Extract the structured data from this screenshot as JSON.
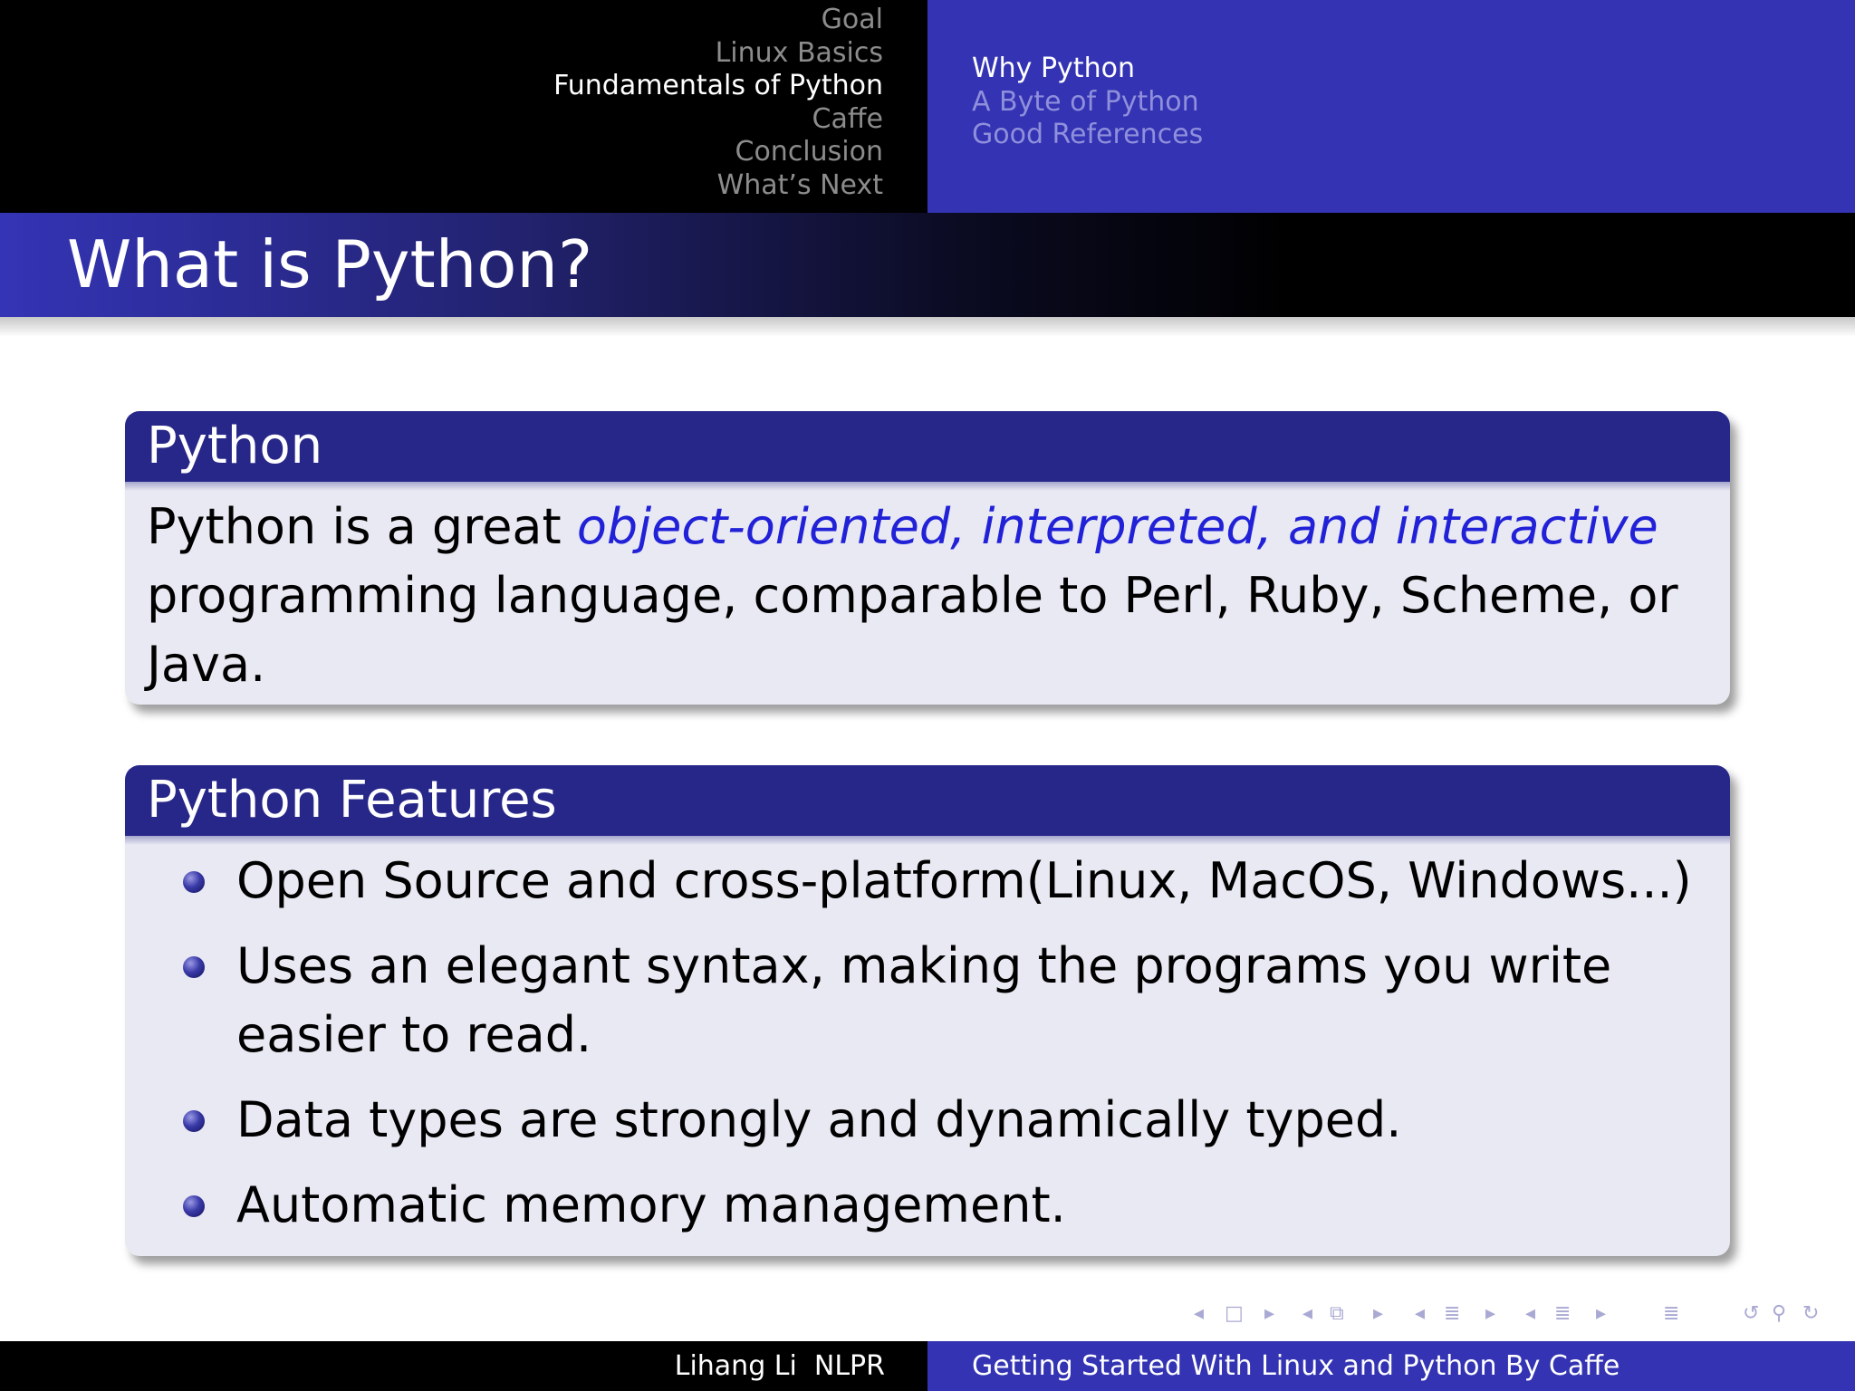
{
  "header": {
    "sections": [
      "Goal",
      "Linux Basics",
      "Fundamentals of Python",
      "Caffe",
      "Conclusion",
      "What’s Next"
    ],
    "active_section": "Fundamentals of Python",
    "subsections": [
      "Why Python",
      "A Byte of Python",
      "Good References"
    ],
    "active_subsection": "Why Python"
  },
  "frame": {
    "title": "What is Python?"
  },
  "block_python": {
    "title": "Python",
    "text_before": "Python is a great ",
    "emphasis": "object-oriented, interpreted, and interactive",
    "text_after": " programming language, comparable to Perl, Ruby, Scheme, or Java."
  },
  "block_features": {
    "title": "Python Features",
    "items": [
      "Open Source and cross-platform(Linux, MacOS, Windows...)",
      "Uses an elegant syntax, making the programs you write easier to read.",
      "Data types are strongly and dynamically typed.",
      "Automatic memory management."
    ]
  },
  "navigation": {
    "symbols": [
      "◂",
      "□",
      "▸",
      "◂",
      "⧉",
      "▸",
      "◂",
      "≣",
      "▸",
      "◂",
      "≣",
      "▸",
      "≣",
      "↺",
      "⚲",
      "↻"
    ],
    "icons": [
      "prev-slide-icon",
      "slide-icon",
      "next-slide-icon",
      "prev-frame-icon",
      "frame-icon",
      "next-frame-icon",
      "prev-subsection-icon",
      "subsection-icon",
      "next-subsection-icon",
      "prev-section-icon",
      "section-icon",
      "next-section-icon",
      "toc-icon",
      "back-icon",
      "search-icon",
      "forward-icon"
    ]
  },
  "footer": {
    "author": "Lihang Li  NLPR",
    "title": "Getting Started With Linux and Python By Caffe"
  },
  "colors": {
    "header_dark": "#000000",
    "header_blue": "#3333b3",
    "block_title_bg": "#272789",
    "block_body_bg": "#e9e9f3",
    "emphasis": "#2121d8"
  }
}
